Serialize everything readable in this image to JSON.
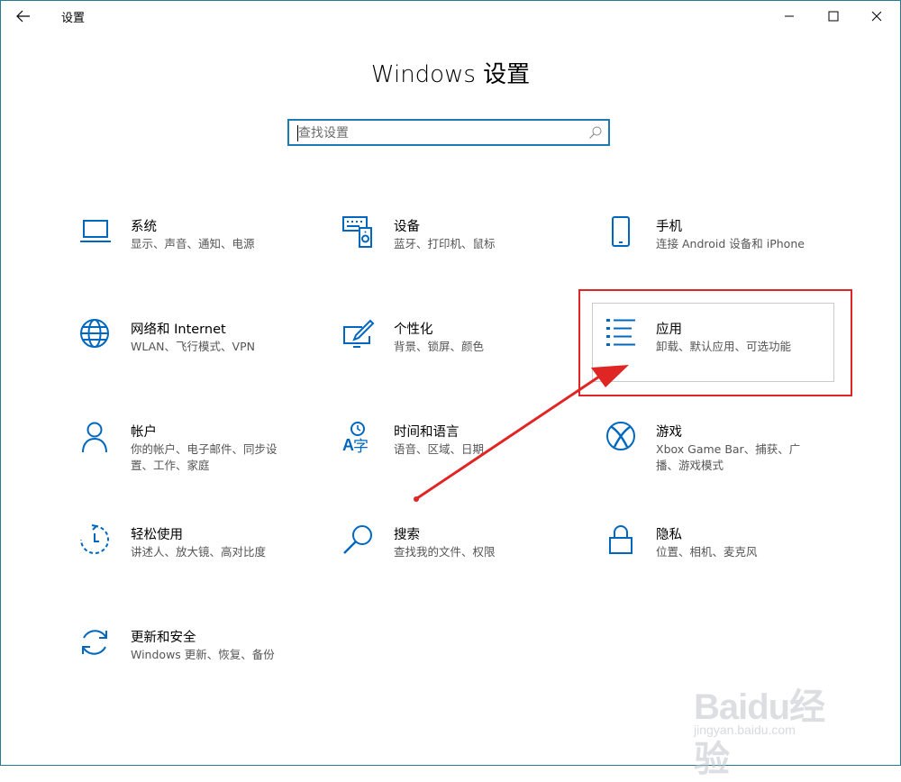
{
  "window": {
    "title": "设置",
    "back_icon": "arrow-left-icon",
    "controls": [
      "minimize-icon",
      "maximize-icon",
      "close-icon"
    ]
  },
  "page_title": "Windows 设置",
  "search": {
    "placeholder": "查找设置",
    "value": ""
  },
  "accent_color": "#0067c0",
  "annotation_color": "#e02525",
  "tiles": [
    {
      "icon": "laptop-icon",
      "title": "系统",
      "desc": "显示、声音、通知、电源"
    },
    {
      "icon": "devices-icon",
      "title": "设备",
      "desc": "蓝牙、打印机、鼠标"
    },
    {
      "icon": "phone-icon",
      "title": "手机",
      "desc": "连接 Android 设备和 iPhone"
    },
    {
      "icon": "globe-icon",
      "title": "网络和 Internet",
      "desc": "WLAN、飞行模式、VPN"
    },
    {
      "icon": "personalization-icon",
      "title": "个性化",
      "desc": "背景、锁屏、颜色"
    },
    {
      "icon": "apps-list-icon",
      "title": "应用",
      "desc": "卸载、默认应用、可选功能"
    },
    {
      "icon": "person-icon",
      "title": "帐户",
      "desc": "你的帐户、电子邮件、同步设置、工作、家庭"
    },
    {
      "icon": "time-language-icon",
      "title": "时间和语言",
      "desc": "语音、区域、日期"
    },
    {
      "icon": "xbox-icon",
      "title": "游戏",
      "desc": "Xbox Game Bar、捕获、广播、游戏模式"
    },
    {
      "icon": "ease-of-access-icon",
      "title": "轻松使用",
      "desc": "讲述人、放大镜、高对比度"
    },
    {
      "icon": "search-icon",
      "title": "搜索",
      "desc": "查找我的文件、权限"
    },
    {
      "icon": "lock-icon",
      "title": "隐私",
      "desc": "位置、相机、麦克风"
    },
    {
      "icon": "update-icon",
      "title": "更新和安全",
      "desc": "Windows 更新、恢复、备份"
    }
  ],
  "watermark": {
    "main": "Baidu经验",
    "sub": "jingyan.baidu.com"
  }
}
